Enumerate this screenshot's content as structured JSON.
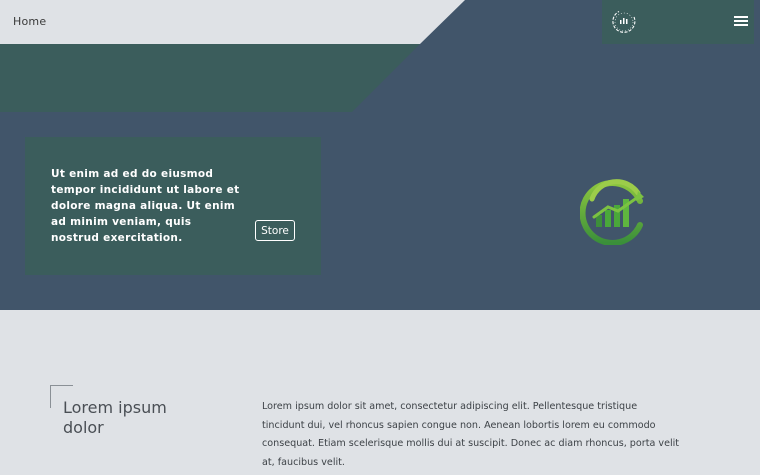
{
  "header": {
    "home_label": "Home",
    "menu_icon": "hamburger-menu-icon",
    "logo_icon": "circular-brand-logo-icon"
  },
  "hero": {
    "card_text": "Ut enim ad ed do eiusmod tempor incididunt ut labore et dolore magna aliqua. Ut enim ad minim veniam, quis nostrud exercitation.",
    "store_button_label": "Store",
    "emblem_icon": "growth-chart-leaf-icon"
  },
  "about": {
    "heading": "Lorem ipsum dolor",
    "body": "Lorem ipsum dolor sit amet, consectetur adipiscing elit. Pellentesque tristique tincidunt dui, vel rhoncus sapien congue non. Aenean lobortis lorem eu commodo consequat. Etiam scelerisque mollis dui at suscipit. Donec ac diam rhoncus, porta velit at, faucibus velit."
  },
  "colors": {
    "page_background": "#dfe2e6",
    "hero_navy": "#41556a",
    "accent_teal": "#3b5d5c",
    "emblem_green": "#4aa83a"
  }
}
